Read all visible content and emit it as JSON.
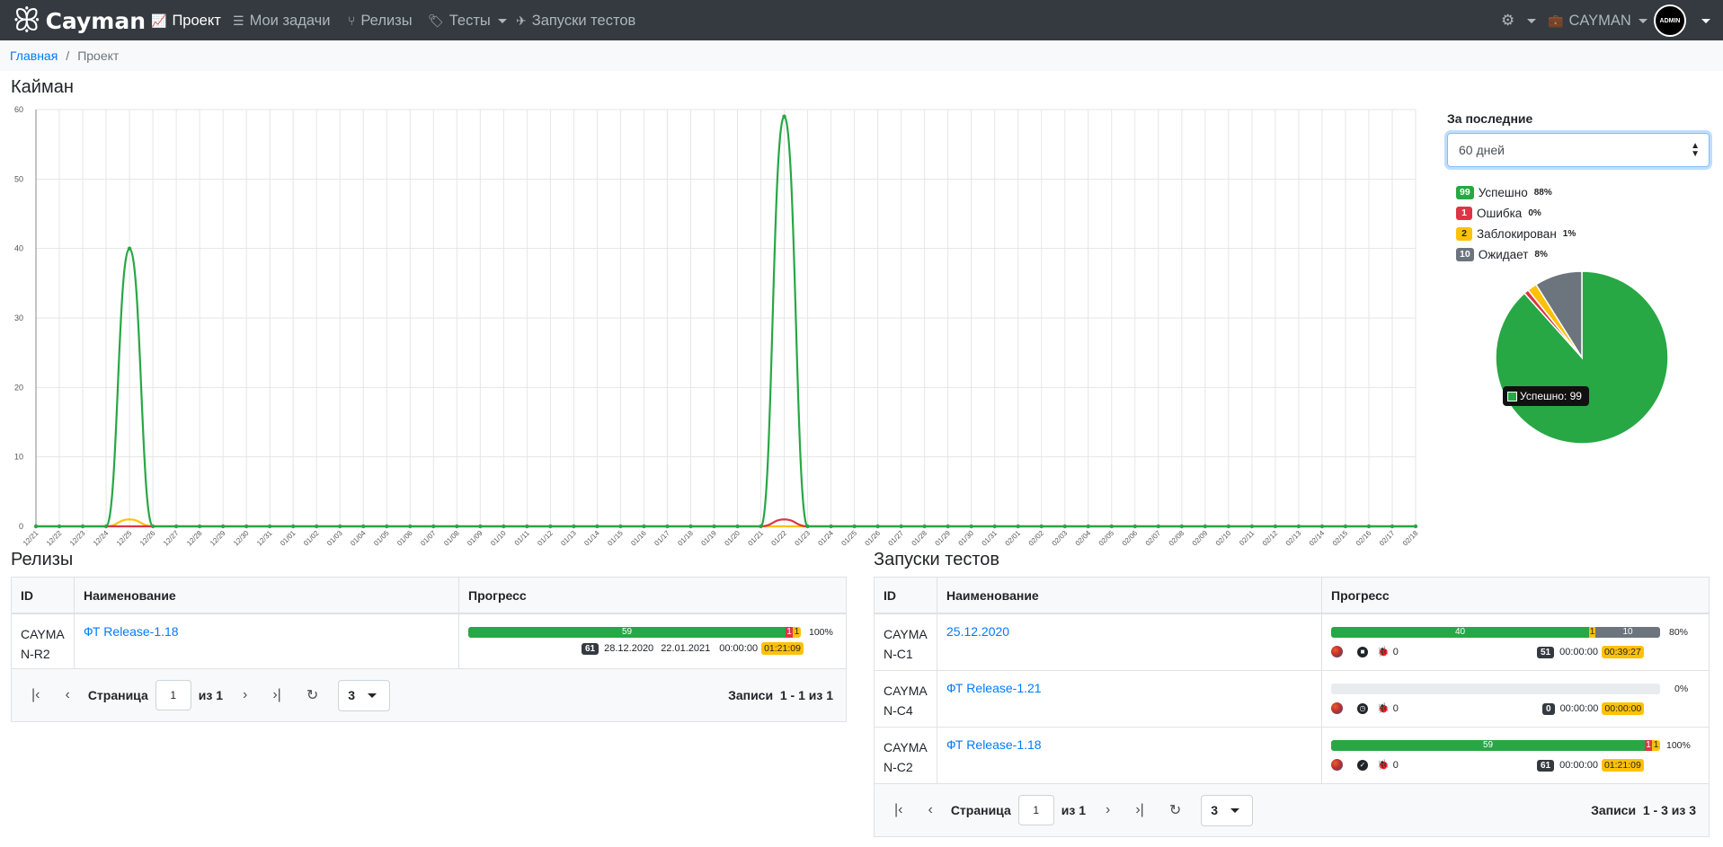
{
  "nav": {
    "brand": "Cayman",
    "items": [
      {
        "label": "Проект",
        "icon": "chart-line-icon"
      },
      {
        "label": "Мои задачи",
        "icon": "tasks-icon"
      },
      {
        "label": "Релизы",
        "icon": "code-branch-icon"
      },
      {
        "label": "Тесты",
        "icon": "tags-icon"
      },
      {
        "label": "Запуски тестов",
        "icon": "plane-icon"
      }
    ],
    "project": "CAYMAN",
    "avatar": "ADMIN"
  },
  "breadcrumb": {
    "home": "Главная",
    "current": "Проект"
  },
  "page_title": "Кайман",
  "filter": {
    "label": "За последние",
    "value": "60 дней"
  },
  "legend": [
    {
      "count": "99",
      "label": "Успешно",
      "pct": "88%",
      "color": "#28a745"
    },
    {
      "count": "1",
      "label": "Ошибка",
      "pct": "0%",
      "color": "#dc3545"
    },
    {
      "count": "2",
      "label": "Заблокирован",
      "pct": "1%",
      "color": "#ffc107"
    },
    {
      "count": "10",
      "label": "Ожидает",
      "pct": "8%",
      "color": "#6c757d"
    }
  ],
  "pie_tooltip": "Успешно: 99",
  "chart_data": [
    {
      "type": "line",
      "x": [
        "12/21",
        "12/22",
        "12/23",
        "12/24",
        "12/25",
        "12/26",
        "12/27",
        "12/28",
        "12/29",
        "12/30",
        "12/31",
        "01/01",
        "01/02",
        "01/03",
        "01/04",
        "01/05",
        "01/06",
        "01/07",
        "01/08",
        "01/09",
        "01/10",
        "01/11",
        "01/12",
        "01/13",
        "01/14",
        "01/15",
        "01/16",
        "01/17",
        "01/18",
        "01/19",
        "01/20",
        "01/21",
        "01/22",
        "01/23",
        "01/24",
        "01/25",
        "01/26",
        "01/27",
        "01/28",
        "01/29",
        "01/30",
        "01/31",
        "02/01",
        "02/02",
        "02/03",
        "02/04",
        "02/05",
        "02/06",
        "02/07",
        "02/08",
        "02/09",
        "02/10",
        "02/11",
        "02/12",
        "02/13",
        "02/14",
        "02/15",
        "02/16",
        "02/17",
        "02/18"
      ],
      "ylim": [
        0,
        60
      ],
      "yticks": [
        0,
        10,
        20,
        30,
        40,
        50,
        60
      ],
      "series": [
        {
          "color": "#28a745",
          "points": {
            "12/25": 40,
            "01/22": 59
          }
        },
        {
          "color": "#dc3545",
          "points": {
            "01/22": 1
          }
        },
        {
          "color": "#ffc107",
          "points": {
            "12/25": 1
          }
        }
      ]
    },
    {
      "type": "pie",
      "values": [
        99,
        1,
        2,
        10
      ],
      "colors": [
        "#28a745",
        "#dc3545",
        "#ffc107",
        "#6c757d"
      ]
    }
  ],
  "releases": {
    "title": "Релизы",
    "columns": [
      "ID",
      "Наименование",
      "Прогресс"
    ],
    "rows": [
      {
        "id": "CAYMAN-R2",
        "name": "ФТ Release-1.18",
        "passed": "59",
        "failed": "1",
        "blocked": "1",
        "percent": "100%",
        "total": "61",
        "start": "28.12.2020",
        "end": "22.01.2021",
        "time": "00:00:00",
        "duration": "01:21:09"
      }
    ],
    "pager": {
      "page_label": "Страница",
      "page": "1",
      "of": "из 1",
      "size": "3",
      "records": "Записи  1 - 1 из 1"
    }
  },
  "runs": {
    "title": "Запуски тестов",
    "columns": [
      "ID",
      "Наименование",
      "Прогресс"
    ],
    "rows": [
      {
        "id": "CAYMAN-C1",
        "name": "25.12.2020",
        "passed": "40",
        "blocked": "1",
        "untested": "10",
        "percent": "80%",
        "bugs": "0",
        "total": "51",
        "time": "00:00:00",
        "duration": "00:39:27",
        "state_icon": "stop-icon"
      },
      {
        "id": "CAYMAN-C4",
        "name": "ФТ Release-1.21",
        "percent": "0%",
        "bugs": "0",
        "total": "0",
        "time": "00:00:00",
        "duration": "00:00:00",
        "state_icon": "clock-icon"
      },
      {
        "id": "CAYMAN-C2",
        "name": "ФТ Release-1.18",
        "passed": "59",
        "failed": "1",
        "blocked": "1",
        "percent": "100%",
        "bugs": "0",
        "total": "61",
        "time": "00:00:00",
        "duration": "01:21:09",
        "state_icon": "check-circle-icon"
      }
    ],
    "pager": {
      "page_label": "Страница",
      "page": "1",
      "of": "из 1",
      "size": "3",
      "records": "Записи  1 - 3 из 3"
    }
  }
}
